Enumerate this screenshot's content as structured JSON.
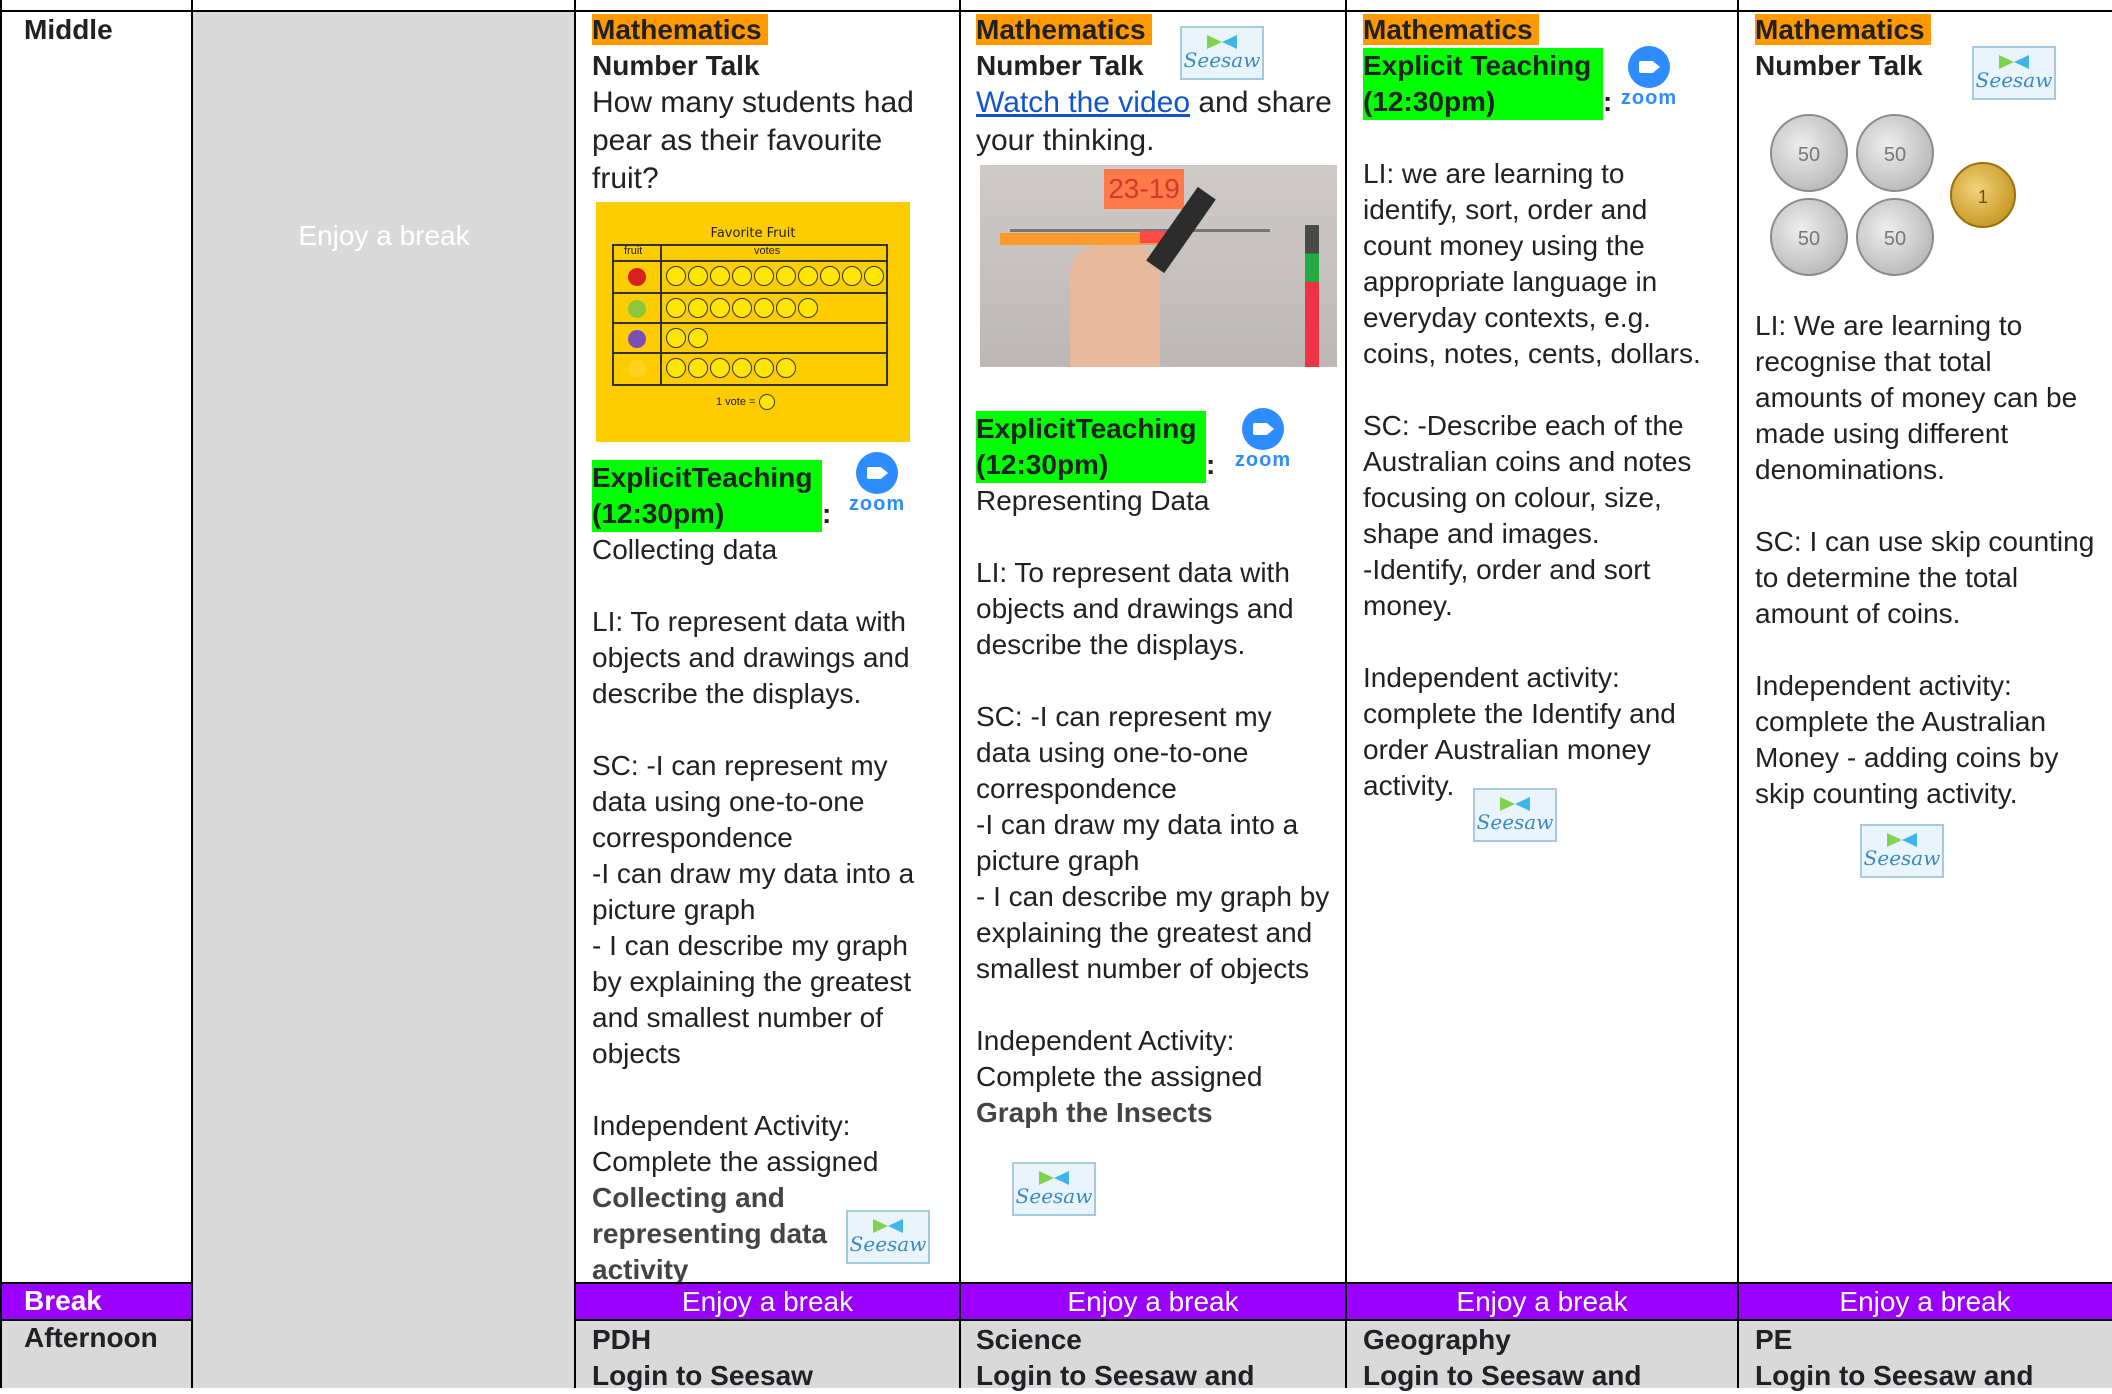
{
  "rows": {
    "middle_label": "Middle",
    "break_label": "Break",
    "afternoon_label": "Afternoon"
  },
  "grey_column": {
    "text": "Enjoy a break"
  },
  "break_text": "Enjoy a break",
  "monday": {
    "subject": "Mathematics",
    "number_talk": "Number Talk",
    "question": "How many students had pear as their favourite fruit?",
    "chart_data": {
      "type": "table",
      "title": "Favorite Fruit",
      "columns": [
        "fruit",
        "votes"
      ],
      "rows": [
        {
          "fruit": "apple-icon",
          "votes": 10
        },
        {
          "fruit": "pear-icon",
          "votes": 7
        },
        {
          "fruit": "grapes-icon",
          "votes": 2
        },
        {
          "fruit": "banana-icon",
          "votes": 6
        }
      ],
      "key": "1 vote ="
    },
    "explicit_label": "ExplicitTeaching (12:30pm)",
    "explicit_colon": ":",
    "topic": "Collecting data",
    "li": "LI: To represent data with objects and drawings and describe the displays.",
    "sc1": "SC: -I can represent my data using one-to-one correspondence",
    "sc2": "-I can draw my data into a picture graph",
    "sc3": "- I can describe my graph by explaining the greatest and smallest number of objects",
    "independent": "Independent Activity: Complete the assigned",
    "activity_bold": "Collecting and representing data activity"
  },
  "tuesday": {
    "subject": "Mathematics",
    "number_talk": "Number Talk",
    "video_link": "Watch the video",
    "video_rest": " and share your thinking.",
    "video_board_text": "23-19",
    "explicit_label": "ExplicitTeaching (12:30pm)",
    "explicit_colon": ":",
    "topic": "Representing Data",
    "li": "LI: To represent data with objects and drawings and describe the displays.",
    "sc1": "SC: -I can represent my data using one-to-one correspondence",
    "sc2": "-I can draw my data into a picture graph",
    "sc3": "- I can describe my graph by explaining the greatest and smallest number of objects",
    "independent": "Independent Activity: Complete the assigned",
    "activity_bold": "Graph the Insects"
  },
  "wednesday": {
    "subject": "Mathematics",
    "explicit_label": "Explicit Teaching (12:30pm)",
    "explicit_colon": ":",
    "li": "LI: we are learning to identify, sort, order and count money using the appropriate language in everyday contexts, e.g. coins, notes, cents, dollars.",
    "sc": "SC: -Describe each of the Australian coins and notes focusing on colour, size, shape and images.",
    "sc2": "-Identify, order and sort money.",
    "independent": "Independent activity: complete the Identify and order Australian money activity."
  },
  "thursday": {
    "subject": "Mathematics",
    "number_talk": "Number Talk",
    "coin_small": "50",
    "coin_gold": "1",
    "li": "LI: We are learning to recognise that total amounts of money can be made using different denominations.",
    "sc": "SC: I can use skip counting to determine the total amount of coins.",
    "independent": "Independent activity: complete the Australian Money - adding coins by skip counting activity."
  },
  "afternoon": {
    "monday": {
      "subject": "PDH",
      "line2": "Login to Seesaw"
    },
    "tuesday": {
      "subject": "Science",
      "line2": "Login to Seesaw and"
    },
    "wednesday": {
      "subject": "Geography",
      "line2": "Login to Seesaw and"
    },
    "thursday": {
      "subject": "PE",
      "line2": "Login to Seesaw and"
    }
  },
  "icons": {
    "seesaw_word": "Seesaw",
    "zoom_word": "zoom"
  },
  "colors": {
    "grey": "#d9d9d9",
    "purple": "#9900ff",
    "orange": "#ff9900",
    "green": "#00ff00",
    "link": "#1155cc"
  }
}
